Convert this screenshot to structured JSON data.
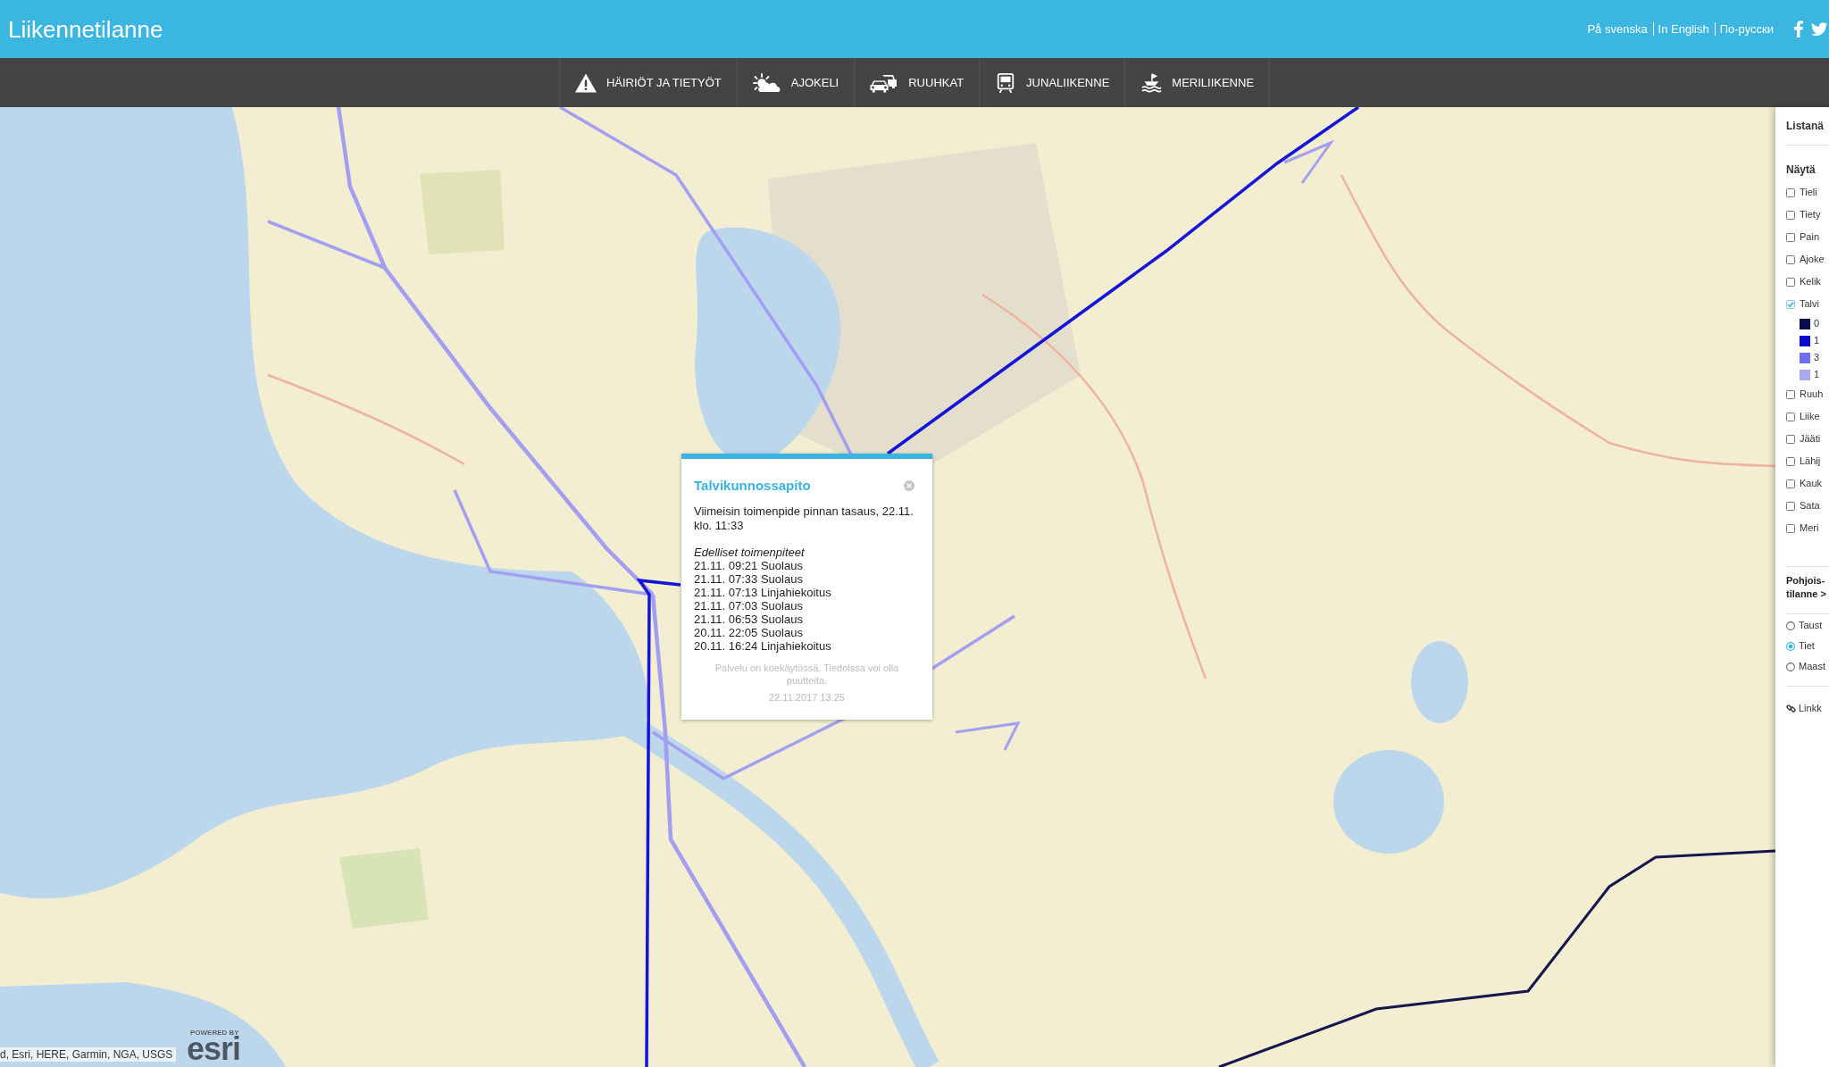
{
  "header": {
    "title": "Liikennetilanne",
    "languages": [
      "På svenska",
      "In English",
      "По-русски"
    ]
  },
  "nav": {
    "items": [
      "HÄIRIÖT JA TIETYÖT",
      "AJOKELI",
      "RUUHKAT",
      "JUNALIIKENNE",
      "MERILIIKENNE"
    ]
  },
  "map": {
    "popup": {
      "title": "Talvikunnossapito",
      "latest": "Viimeisin toimenpide pinnan tasaus, 22.11. klo. 11:33",
      "history_heading": "Edelliset toimenpiteet",
      "history": [
        "21.11. 09:21 Suolaus",
        "21.11. 07:33 Suolaus",
        "21.11. 07:13 Linjahiekoitus",
        "21.11. 07:03 Suolaus",
        "21.11. 06:53 Suolaus",
        "20.11. 22:05 Suolaus",
        "20.11. 16:24 Linjahiekoitus"
      ],
      "notice": "Palvelu on koekäytössä. Tiedoissa voi olla puutteita.",
      "timestamp": "22.11.2017 13.25"
    },
    "attribution": "d, Esri, HERE, Garmin, NGA, USGS",
    "logo": {
      "tagline": "POWERED BY",
      "name": "esri"
    }
  },
  "sidebar": {
    "title": "Listanä",
    "layers_heading": "Näytä",
    "layers": [
      {
        "label": "Tieli",
        "checked": false
      },
      {
        "label": "Tiety",
        "checked": false
      },
      {
        "label": "Pain",
        "checked": false
      },
      {
        "label": "Ajoke",
        "checked": false
      },
      {
        "label": "Kelik",
        "checked": false
      },
      {
        "label": "Talvi",
        "checked": true,
        "legend": [
          {
            "label": "0",
            "color": "#0b0b4f"
          },
          {
            "label": "1",
            "color": "#0a0ad0"
          },
          {
            "label": "3",
            "color": "#6e6ef0"
          },
          {
            "label": "1",
            "color": "#a9a9f2"
          }
        ]
      },
      {
        "label": "Ruuh",
        "checked": false
      },
      {
        "label": "Liike",
        "checked": false
      },
      {
        "label": "Jääti",
        "checked": false
      },
      {
        "label": "Lähij",
        "checked": false
      },
      {
        "label": "Kauk",
        "checked": false
      },
      {
        "label": "Sata",
        "checked": false
      },
      {
        "label": "Meri",
        "checked": false
      }
    ],
    "region_link": "Pohjois- tilanne >",
    "basemaps": [
      {
        "label": "Taust",
        "selected": false
      },
      {
        "label": "Tiet",
        "selected": true
      },
      {
        "label": "Maast",
        "selected": false
      }
    ],
    "link": "Linkk"
  }
}
